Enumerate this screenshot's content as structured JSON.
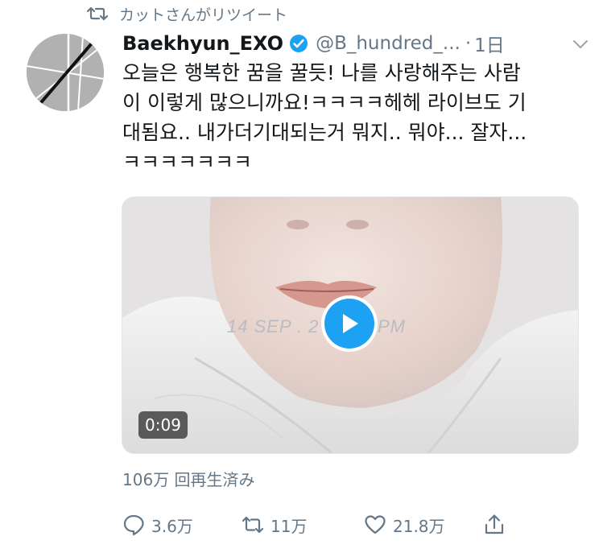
{
  "retweet_banner": {
    "text": "カットさんがリツイート",
    "icon": "retweet-icon"
  },
  "tweet": {
    "author_name": "Baekhyun_EXO",
    "verified": true,
    "handle": "@B_hundred_...",
    "separator": "·",
    "time": "1日",
    "text_lines": [
      "오늘은 행복한 꿈을 꿀듯! 나를 사랑해주는 사람",
      "이 이렇게 많으니까요!ㅋㅋㅋㅋ헤헤 라이브도 기",
      "대됨요.. 내가더기대되는거 뭐지.. 뭐야... 잘자...",
      "ㅋㅋㅋㅋㅋㅋㅋ"
    ]
  },
  "media": {
    "stamp_text": "14 SEP . 2  11:22  PM",
    "duration": "0:09",
    "play_color": "#1da1f2"
  },
  "views": "106万 回再生済み",
  "actions": {
    "reply_count": "3.6万",
    "retweet_count": "11万",
    "like_count": "21.8万"
  },
  "colors": {
    "accent": "#1da1f2",
    "muted": "#657786",
    "text": "#14171a"
  }
}
